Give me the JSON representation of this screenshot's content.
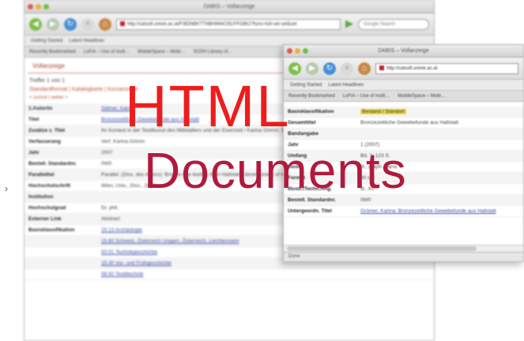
{
  "overlay": {
    "line1": "HTML",
    "line2": "Documents"
  },
  "back_window": {
    "title": "DABIS – Vollanzeige",
    "url": "http://catsofi.univie.ac.at/F/8DNBKTTNBHIM4CI5LFFG8K2?func=full-set-set&set",
    "search_placeholder": "Google Search",
    "bookmarks": [
      "Getting Started",
      "Latest Headlines"
    ],
    "tabs": [
      "Recently Bookmarked",
      "LoFiA – Use of mult…",
      "MobileSpace – Mobi…",
      "SOSH Library of…"
    ],
    "page_heading": "Vollanzeige",
    "hits": "Treffer 1 von 1",
    "formats": "Standardformat | Katalogkarte | Kurzanzeige",
    "actions": "< zurück | weiter >",
    "fields": [
      {
        "key": "1.Autor/in",
        "value": "Sidmer, Karina",
        "style": "link"
      },
      {
        "key": "Titel",
        "value": "Bronzezeitliche Gewebefunde aus Hallstatt",
        "style": "link"
      },
      {
        "key": "Zusätze z. Titel",
        "value": "Ihr Kontext in der Textilkunst des Mittelalters und der Eisenzeit / Karina Grimm, Beatriz",
        "style": "text"
      },
      {
        "key": "Verfasserang",
        "value": "Verf. Karina Grimm",
        "style": "text"
      },
      {
        "key": "Jahr",
        "value": "2007",
        "style": "text"
      },
      {
        "key": "Bestell. Standardnr.",
        "value": "0W0",
        "style": "text"
      },
      {
        "key": "Parallelitel",
        "value": "Parallel: (Diss. des Autors): Bronze Age textiles from Hallstatt ; development of textile technology from bronze age to iron age",
        "style": "text"
      },
      {
        "key": "Hochschulschrift",
        "value": "Wien, Univ., Diss., 2007",
        "style": "text"
      },
      {
        "key": "Institution",
        "value": "",
        "style": "text"
      },
      {
        "key": "Hochschulgrad",
        "value": "Dr. phil.",
        "style": "text"
      },
      {
        "key": "Externer Link",
        "value": "Abstract",
        "style": "text"
      },
      {
        "key": "Basisklassifikation",
        "value": "15.13 Archäologie",
        "style": "link"
      },
      {
        "key": "",
        "value": "15.60 Schweiz, Österreich Ungarn, Österreich, Liechtenstein",
        "style": "link"
      },
      {
        "key": "",
        "value": "50.01 Technikgeschichte",
        "style": "link"
      },
      {
        "key": "",
        "value": "15.30 Vor- und Frühgeschichte",
        "style": "link"
      },
      {
        "key": "",
        "value": "58.50 Textiltechnik",
        "style": "link"
      }
    ]
  },
  "front_window": {
    "title": "DABIS – Vollanzeige",
    "url": "http://catsofi.univie.ac.at",
    "bookmarks": [
      "Getting Started",
      "Latest Headlines"
    ],
    "tabs": [
      "Recently Bookmarked",
      "LoFiA – Use of multi…",
      "MobileSpace – Mobi…"
    ],
    "fields": [
      {
        "key": "Basisklassifikation",
        "value": "Bestand / Standort",
        "style": "highlight"
      },
      {
        "key": "Gesamttitel",
        "value": "Bronzezeitliche Gewebefunde aus Hallstatt",
        "style": "text"
      },
      {
        "key": "Bandangabe",
        "value": "",
        "style": "text"
      },
      {
        "key": "Jahr",
        "value": "1 (2007)",
        "style": "text"
      },
      {
        "key": "Umfang",
        "value": "Bd. 1: 123 S.",
        "style": "text"
      },
      {
        "key": "Illustr.",
        "value": "Ill., graph. Darst.",
        "style": "text"
      },
      {
        "key": "Format",
        "value": "30 cm",
        "style": "text"
      },
      {
        "key": "Illustr./Techn.Ang.",
        "value": "Ill., Kt.",
        "style": "text"
      },
      {
        "key": "Bestell. Standardnr.",
        "value": "0W0",
        "style": "text"
      },
      {
        "key": "Untergeordn. Titel",
        "value": "Grömer, Karina: Bronzezeitliche Gewebefunde aus Hallstatt",
        "style": "link"
      }
    ],
    "status": "Done"
  }
}
